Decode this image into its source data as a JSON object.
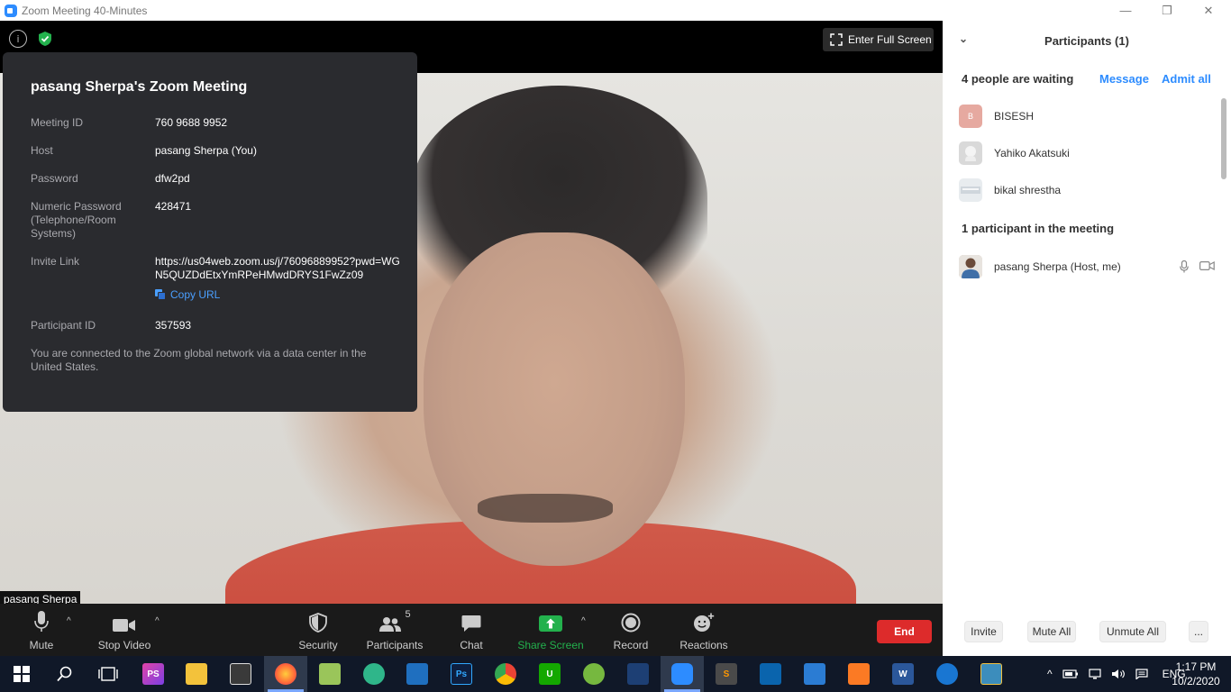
{
  "window": {
    "title": "Zoom Meeting 40-Minutes",
    "minimize": "—",
    "restore": "❐",
    "close": "✕"
  },
  "topbar": {
    "fullscreen_label": "Enter Full Screen"
  },
  "info": {
    "title": "pasang Sherpa's Zoom Meeting",
    "rows": [
      {
        "key": "Meeting ID",
        "value": "760 9688 9952"
      },
      {
        "key": "Host",
        "value": "pasang Sherpa (You)"
      },
      {
        "key": "Password",
        "value": "dfw2pd"
      },
      {
        "key": "Numeric Password (Telephone/Room Systems)",
        "value": "428471"
      },
      {
        "key": "Invite Link",
        "value": "https://us04web.zoom.us/j/76096889952?pwd=WGN5QUZDdEtxYmRPeHMwdDRYS1FwZz09"
      },
      {
        "key": "Participant ID",
        "value": "357593"
      }
    ],
    "copy_url": "Copy URL",
    "footer": "You are connected to the Zoom global network via a data center in the United States."
  },
  "video": {
    "name_tag": "pasang Sherpa"
  },
  "toolbar": {
    "mute": "Mute",
    "stop_video": "Stop Video",
    "security": "Security",
    "participants": "Participants",
    "participants_count": "5",
    "chat": "Chat",
    "share_screen": "Share Screen",
    "record": "Record",
    "reactions": "Reactions",
    "end": "End",
    "caret": "^"
  },
  "participants_panel": {
    "header": "Participants (1)",
    "chevron": "⌄",
    "waiting_label": "4 people are waiting",
    "message_label": "Message",
    "admit_all_label": "Admit all",
    "waiting": [
      {
        "name": "BISESH",
        "initial": "B"
      },
      {
        "name": "Yahiko Akatsuki",
        "initial": ""
      },
      {
        "name": "bikal shrestha",
        "initial": ""
      }
    ],
    "in_meeting_label": "1 participant in the meeting",
    "in_meeting": [
      {
        "name": "pasang Sherpa (Host, me)"
      }
    ],
    "footer": {
      "invite": "Invite",
      "mute_all": "Mute All",
      "unmute_all": "Unmute All",
      "more": "..."
    }
  },
  "taskbar": {
    "language": "ENG",
    "time": "1:17 PM",
    "date": "10/2/2020",
    "apps": [
      "start-icon",
      "search-icon",
      "task-view-icon",
      "phpstorm-icon",
      "file-explorer-icon",
      "store-icon",
      "firefox-icon",
      "files-icon",
      "atom-icon",
      "vscode-icon",
      "photoshop-icon",
      "chrome-icon",
      "upwork-icon",
      "utorrent-icon",
      "mendeley-icon",
      "zoom-icon",
      "sublime-icon",
      "outlook-icon",
      "ms-teams-icon",
      "xampp-icon",
      "word-icon",
      "alarm-icon",
      "photos-icon"
    ]
  }
}
